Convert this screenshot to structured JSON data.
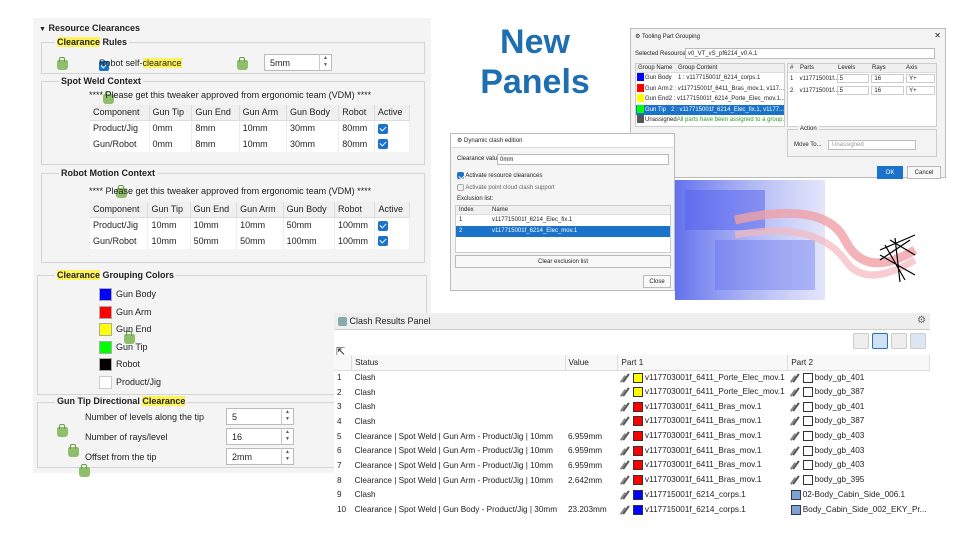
{
  "left": {
    "section_title": "Resource Clearances",
    "clearance_rules": {
      "title_hl": "Clearance",
      "title_rest": " Rules",
      "robot_label_a": "Robot self-",
      "robot_label_hl": "clearance",
      "robot_value": "5mm"
    },
    "spot_weld": {
      "title": "Spot Weld Context",
      "note": "**** Please get this tweaker approved from ergonomic team (VDM) ****",
      "headers": [
        "Component",
        "Gun Tip",
        "Gun End",
        "Gun Arm",
        "Gun Body",
        "Robot",
        "Active"
      ],
      "rows": [
        [
          "Product/Jig",
          "0mm",
          "8mm",
          "10mm",
          "30mm",
          "80mm"
        ],
        [
          "Gun/Robot",
          "0mm",
          "8mm",
          "10mm",
          "30mm",
          "80mm"
        ]
      ]
    },
    "robot_motion": {
      "title": "Robot Motion Context",
      "note": "**** Please get this tweaker approved from ergonomic team (VDM) ****",
      "headers": [
        "Component",
        "Gun Tip",
        "Gun End",
        "Gun Arm",
        "Gun Body",
        "Robot",
        "Active"
      ],
      "rows": [
        [
          "Product/Jig",
          "10mm",
          "10mm",
          "10mm",
          "50mm",
          "100mm"
        ],
        [
          "Gun/Robot",
          "10mm",
          "50mm",
          "50mm",
          "100mm",
          "100mm"
        ]
      ]
    },
    "grouping": {
      "title_hl": "Clearance",
      "title_rest": " Grouping Colors",
      "items": [
        {
          "label": "Gun Body",
          "color": "#0000ff"
        },
        {
          "label": "Gun Arm",
          "color": "#ff0000"
        },
        {
          "label": "Gun End",
          "color": "#ffff00"
        },
        {
          "label": "Gun Tip",
          "color": "#00ff00"
        },
        {
          "label": "Robot",
          "color": "#000000"
        },
        {
          "label": "Product/Jig",
          "color": "#ffffff"
        }
      ]
    },
    "directional": {
      "title_a": "Gun Tip Directional ",
      "title_hl": "Clearance",
      "fields": [
        {
          "label": "Number of levels along the tip",
          "value": "5"
        },
        {
          "label": "Number of rays/level",
          "value": "16"
        },
        {
          "label": "Offset from the tip",
          "value": "2mm"
        }
      ]
    }
  },
  "headline": [
    "New",
    "Panels"
  ],
  "tooling": {
    "title": "Tooling Part Grouping",
    "selected_label": "Selected Resource:",
    "selected_value": "v0_VT_vS_pf6214_v0 A.1",
    "headers": [
      "Group Name",
      "Group Content"
    ],
    "groups": [
      {
        "name": "Gun Body",
        "color": "#0000ff",
        "content": "1 : v117715001f_6214_corps.1"
      },
      {
        "name": "Gun Arm",
        "color": "#ff0000",
        "content": "2 : v117715001f_6411_Bras_mov.1, v117..."
      },
      {
        "name": "Gun End",
        "color": "#ffff00",
        "content": "2 : v117715001f_6214_Porte_Elec_mov.1..."
      },
      {
        "name": "Gun Tip",
        "color": "#00ff00",
        "content": "2 : v117715001f_6214_Elec_fix.1, v1177..."
      },
      {
        "name": "Unassigned",
        "color": "#555555",
        "content": "All parts have been assigned to a group."
      }
    ],
    "rhdr": [
      "#",
      "Parts",
      "Levels",
      "Rays",
      "Axis"
    ],
    "rrows": [
      [
        "1",
        "v117715001f...",
        "5",
        "16",
        "Y+"
      ],
      [
        "2",
        "v117715001f...",
        "5",
        "16",
        "Y+"
      ]
    ],
    "action_label": "Action",
    "move_label": "Move To...",
    "move_value": "Unassigned",
    "ok": "OK",
    "cancel": "Cancel"
  },
  "dynamic": {
    "title": "Dynamic clash edition",
    "clearance_label": "Clearance value:",
    "clearance_value": "0mm",
    "opt1": "Activate resource clearances",
    "opt2": "Activate point cloud clash support",
    "excl_label": "Exclusion list:",
    "headers": [
      "Index",
      "Name"
    ],
    "rows": [
      [
        "1",
        "v117715001f_6214_Elec_fix.1"
      ],
      [
        "2",
        "v117715001f_6214_Elec_mov.1"
      ]
    ],
    "clear_btn": "Clear exclusion list",
    "close_btn": "Close"
  },
  "clash": {
    "title": "Clash Results Panel",
    "headers": [
      "Status",
      "Value",
      "Part 1",
      "Part 2"
    ],
    "rows": [
      {
        "n": "1",
        "status": "Clash",
        "value": "",
        "c1": "#ffff00",
        "p1": "v117703001f_6411_Porte_Elec_mov.1",
        "p2": "body_gb_401"
      },
      {
        "n": "2",
        "status": "Clash",
        "value": "",
        "c1": "#ffff00",
        "p1": "v117703001f_6411_Porte_Elec_mov.1",
        "p2": "body_gb_387"
      },
      {
        "n": "3",
        "status": "Clash",
        "value": "",
        "c1": "#ff0000",
        "p1": "v117703001f_6411_Bras_mov.1",
        "p2": "body_gb_401"
      },
      {
        "n": "4",
        "status": "Clash",
        "value": "",
        "c1": "#ff0000",
        "p1": "v117703001f_6411_Bras_mov.1",
        "p2": "body_gb_387"
      },
      {
        "n": "5",
        "status": "Clearance | Spot Weld | Gun Arm - Product/Jig | 10mm",
        "value": "6.959mm",
        "c1": "#ff0000",
        "p1": "v117703001f_6411_Bras_mov.1",
        "p2": "body_gb_403"
      },
      {
        "n": "6",
        "status": "Clearance | Spot Weld | Gun Arm - Product/Jig | 10mm",
        "value": "6.959mm",
        "c1": "#ff0000",
        "p1": "v117703001f_6411_Bras_mov.1",
        "p2": "body_gb_403"
      },
      {
        "n": "7",
        "status": "Clearance | Spot Weld | Gun Arm - Product/Jig | 10mm",
        "value": "6.959mm",
        "c1": "#ff0000",
        "p1": "v117703001f_6411_Bras_mov.1",
        "p2": "body_gb_403"
      },
      {
        "n": "8",
        "status": "Clearance | Spot Weld | Gun Arm - Product/Jig | 10mm",
        "value": "2.642mm",
        "c1": "#ff0000",
        "p1": "v117703001f_6411_Bras_mov.1",
        "p2": "body_gb_395"
      },
      {
        "n": "9",
        "status": "Clash",
        "value": "",
        "c1": "#0000ff",
        "p1": "v117715001f_6214_corps.1",
        "p2": "02-Body_Cabin_Side_006.1"
      },
      {
        "n": "10",
        "status": "Clearance | Spot Weld | Gun Body - Product/Jig | 30mm",
        "value": "23.203mm",
        "c1": "#0000ff",
        "p1": "v117715001f_6214_corps.1",
        "p2": "Body_Cabin_Side_002_EKY_Pr..."
      }
    ]
  }
}
